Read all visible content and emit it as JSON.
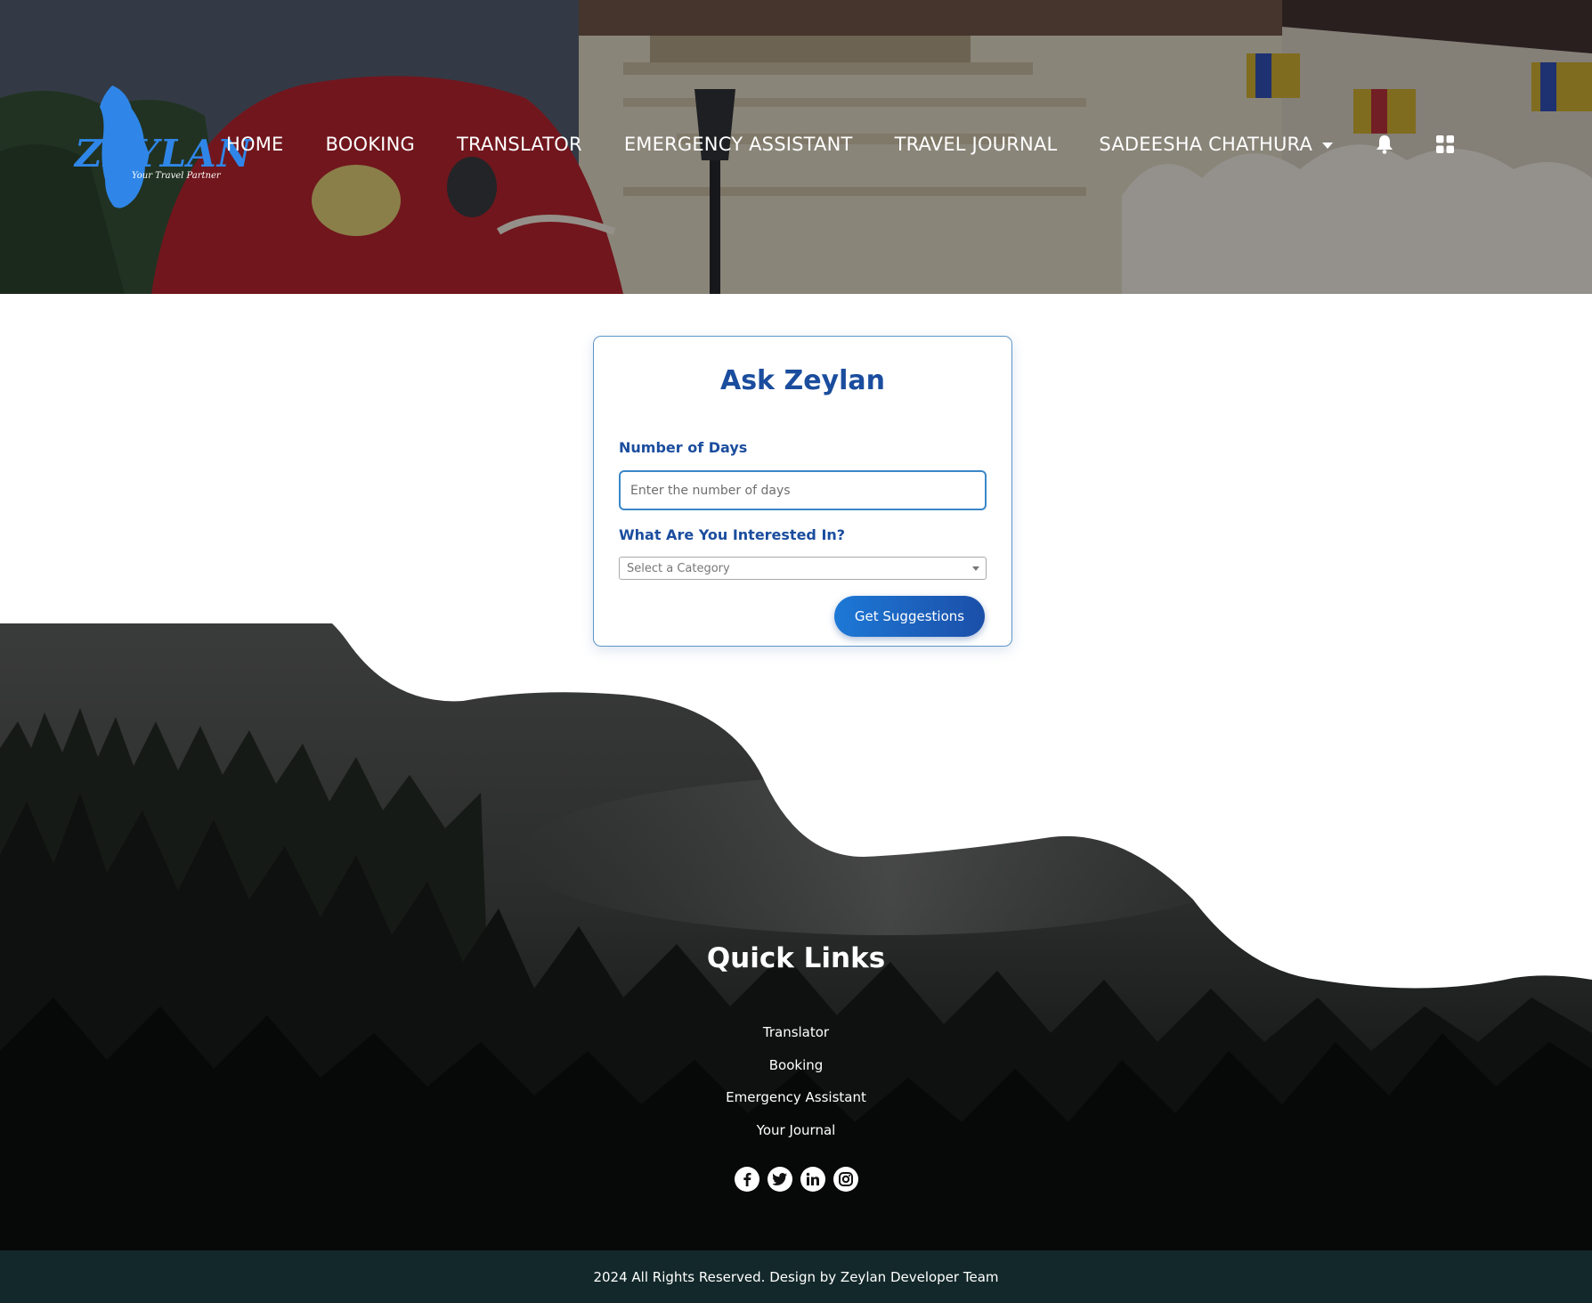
{
  "header": {
    "logo": {
      "name": "ZEYLAN",
      "tagline": "Your Travel Partner"
    },
    "nav": [
      {
        "label": "HOME"
      },
      {
        "label": "BOOKING"
      },
      {
        "label": "TRANSLATOR"
      },
      {
        "label": "EMERGENCY ASSISTANT"
      },
      {
        "label": "TRAVEL JOURNAL"
      }
    ],
    "user": {
      "name": "SADEESHA CHATHURA",
      "icon": "chevron-down-icon"
    },
    "icons": [
      "bell-icon",
      "apps-grid-icon"
    ]
  },
  "form": {
    "title": "Ask Zeylan",
    "days_label": "Number of Days",
    "days_placeholder": "Enter the number of days",
    "days_value": "",
    "interest_label": "What Are You Interested In?",
    "category_value": "Select a Category",
    "submit_label": "Get Suggestions"
  },
  "footer": {
    "title": "Quick Links",
    "links": [
      {
        "label": "Translator"
      },
      {
        "label": "Booking"
      },
      {
        "label": "Emergency Assistant"
      },
      {
        "label": "Your Journal"
      }
    ],
    "social": [
      "facebook-icon",
      "twitter-icon",
      "linkedin-icon",
      "instagram-icon"
    ],
    "copyright": "2024 All Rights Reserved. Design by Zeylan Developer Team"
  },
  "colors": {
    "accent": "#1b4d9e",
    "button": "#1d78d6",
    "logo": "#2f86e8",
    "footer_bar": "#13282a"
  }
}
